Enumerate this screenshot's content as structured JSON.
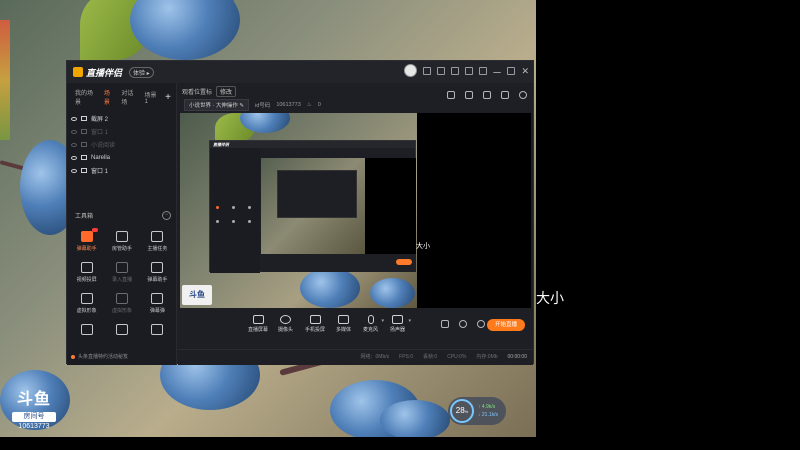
{
  "app": {
    "title": "直播伴侣",
    "version_badge": "体验 ▸"
  },
  "scenes": {
    "tabs": [
      "我的场景",
      "场景",
      "对话场",
      "场景1"
    ],
    "active_index": 1,
    "add": "+"
  },
  "sources": [
    {
      "label": "截屏 2",
      "visible": true
    },
    {
      "label": "窗口 1",
      "visible": false
    },
    {
      "label": "小说阅读",
      "visible": false
    },
    {
      "label": "Narella",
      "visible": true
    },
    {
      "label": "窗口 1",
      "visible": true
    }
  ],
  "tools": {
    "header": "工具箱",
    "collapse": "−",
    "items": [
      {
        "label": "弹幕助手",
        "hot": true
      },
      {
        "label": "房管助手",
        "hot": false
      },
      {
        "label": "主播任务",
        "hot": false
      },
      {
        "label": "视频投屏",
        "hot": false
      },
      {
        "label": "录入直播",
        "hot": false,
        "dim": true
      },
      {
        "label": "弹幕助手",
        "hot": false
      },
      {
        "label": "虚拟形象",
        "hot": false
      },
      {
        "label": "虚拟形象",
        "hot": false,
        "dim": true
      },
      {
        "label": "弹幕弹",
        "hot": false
      },
      {
        "label": "",
        "hot": false
      },
      {
        "label": "",
        "hot": false
      },
      {
        "label": "",
        "hot": false
      }
    ]
  },
  "notice": "头条直播特约活动秘笈",
  "room": {
    "tab": "观看位置标",
    "edit_button": "修改",
    "category": "小说世界 · 大伸操作",
    "category_edit": "✎",
    "id_label": "id号码",
    "room_id": "10613773",
    "heat": "0"
  },
  "preview": {
    "label": "大小"
  },
  "nested": {
    "title": "直播伴侣"
  },
  "controls": {
    "items": [
      "直播屏幕",
      "摄像头",
      "手机投屏",
      "多媒体",
      "麦克风",
      "扬声器"
    ],
    "start_button": "开始直播"
  },
  "status": {
    "items": [
      "网络：0Mb/s",
      "FPS:0",
      "丢帧:0",
      "CPU:0%",
      "内存:0Mb"
    ],
    "timer": "00:00:00"
  },
  "side_text": "大小",
  "douyu": {
    "logo": "斗鱼",
    "sub": "房间号",
    "number": "10613773"
  },
  "speed": {
    "value": "28",
    "unit": "%",
    "up": "↑ 4.9k/s",
    "down": "↓ 21.1k/s"
  }
}
